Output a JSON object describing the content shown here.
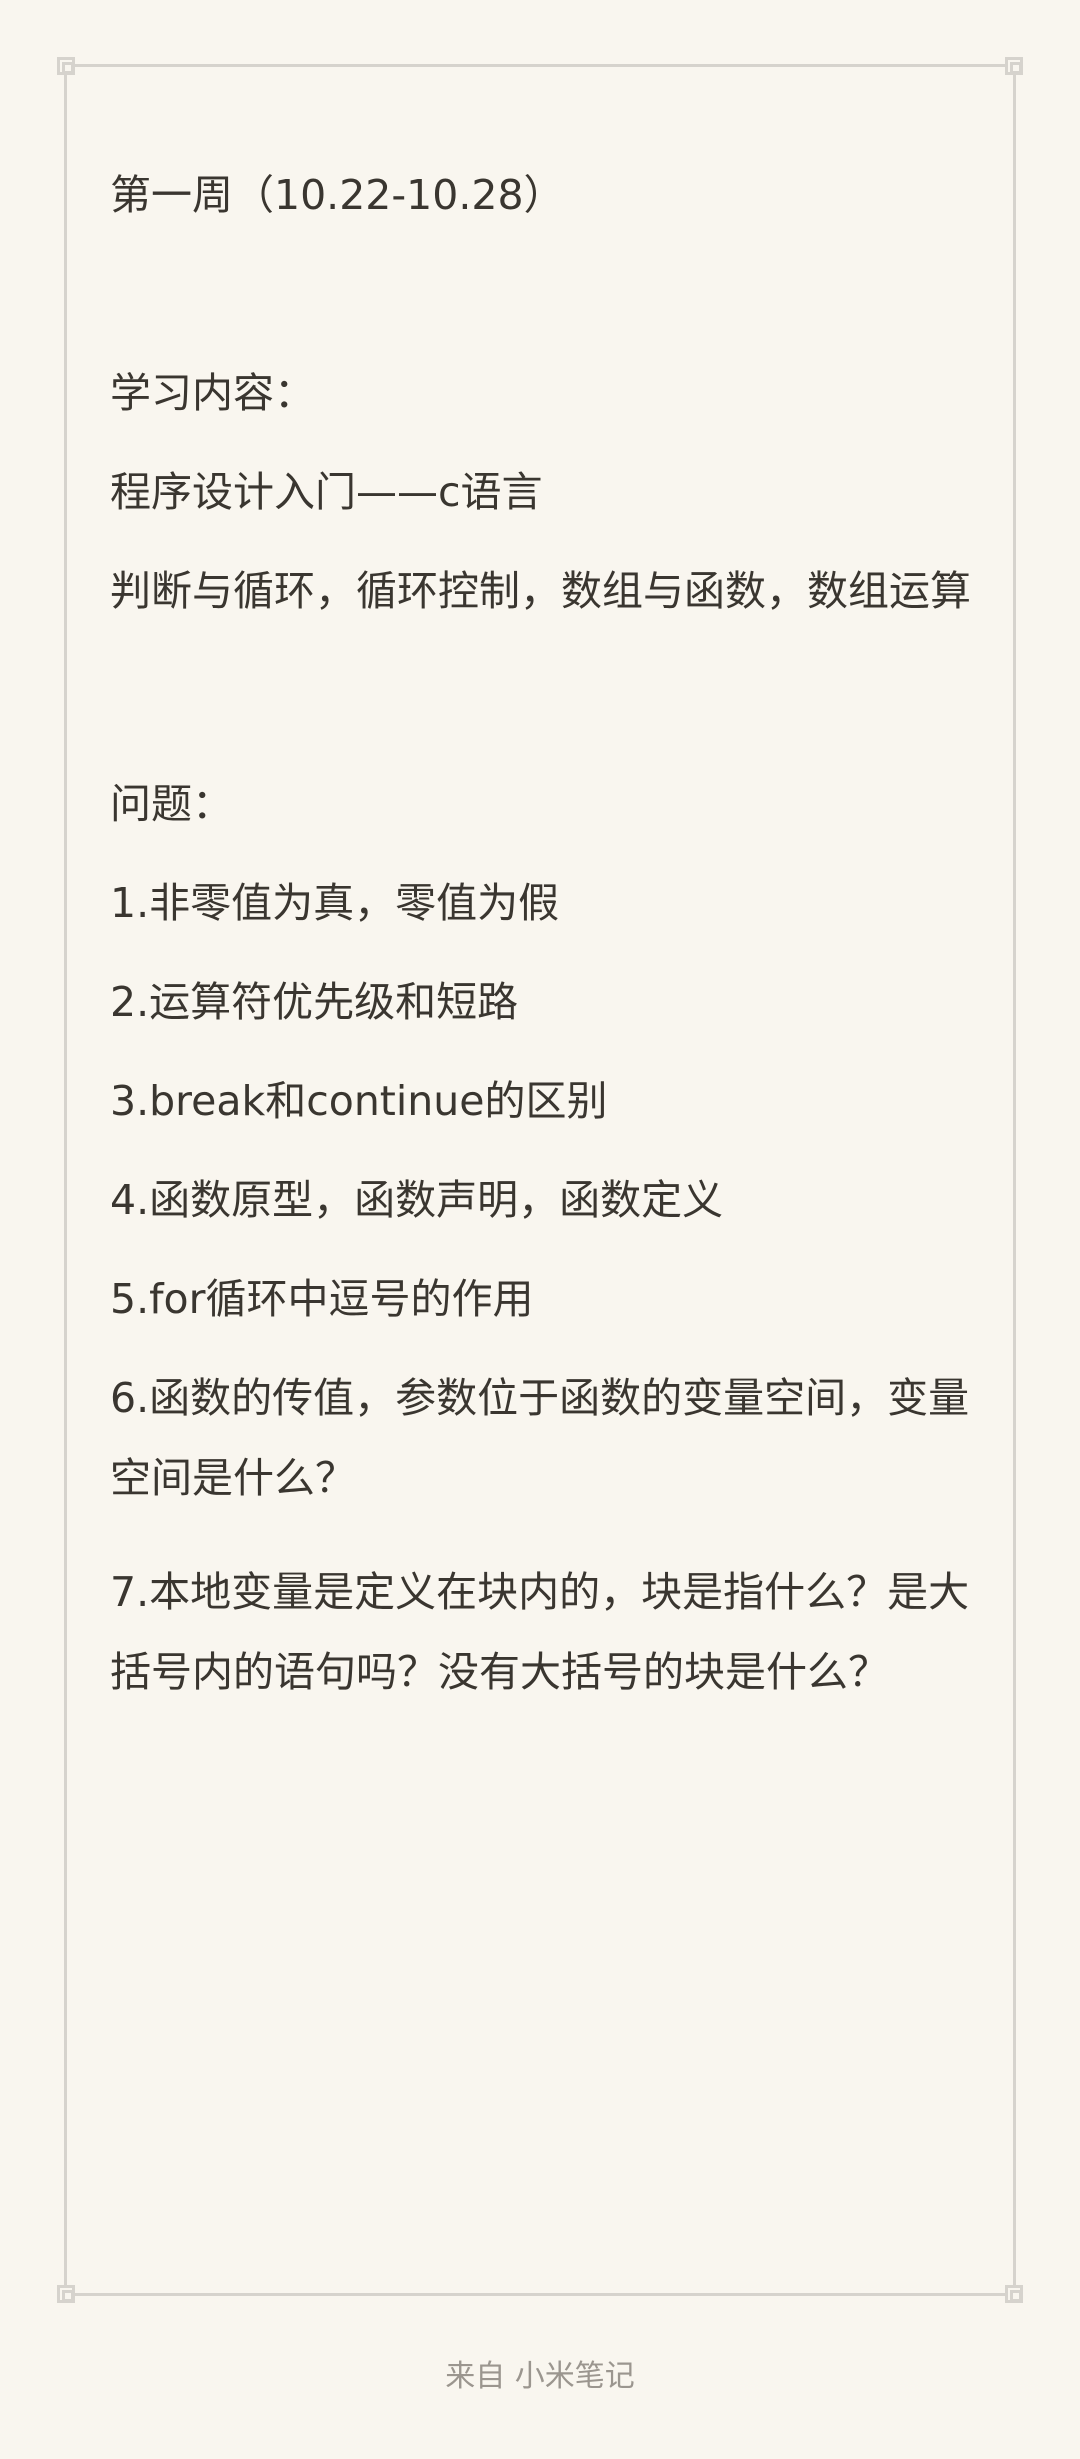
{
  "note": {
    "title": "第一周（10.22-10.28）",
    "section_content_label": "学习内容：",
    "course": "程序设计入门——c语言",
    "topics": "判断与循环，循环控制，数组与函数，数组运算",
    "section_questions_label": "问题：",
    "questions": [
      "1.非零值为真，零值为假",
      "2.运算符优先级和短路",
      "3.break和continue的区别",
      "4.函数原型，函数声明，函数定义",
      "5.for循环中逗号的作用",
      "6.函数的传值，参数位于函数的变量空间，变量空间是什么？",
      "7.本地变量是定义在块内的，块是指什么？是大括号内的语句吗？没有大括号的块是什么？"
    ]
  },
  "footer": {
    "source": "来自 小米笔记"
  }
}
